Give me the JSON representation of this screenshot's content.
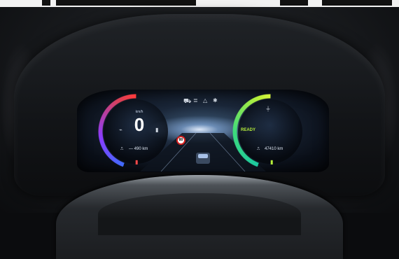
{
  "cluster": {
    "speed_value": "0",
    "speed_unit": "km/h",
    "range_label": "— 490 km",
    "odometer_label": "47410 km",
    "status_label": "READY",
    "speed_limit": "80",
    "top_icons": [
      "car-icon",
      "headlight-icon",
      "warning-icon",
      "star-icon"
    ]
  },
  "colors": {
    "left_gauge": "#3f6cff",
    "left_gauge_end": "#ff3b3b",
    "right_gauge": "#1cc8a0",
    "right_gauge_end": "#d5f33d",
    "ready": "#b6ef3a",
    "sign_border": "#d62020"
  }
}
